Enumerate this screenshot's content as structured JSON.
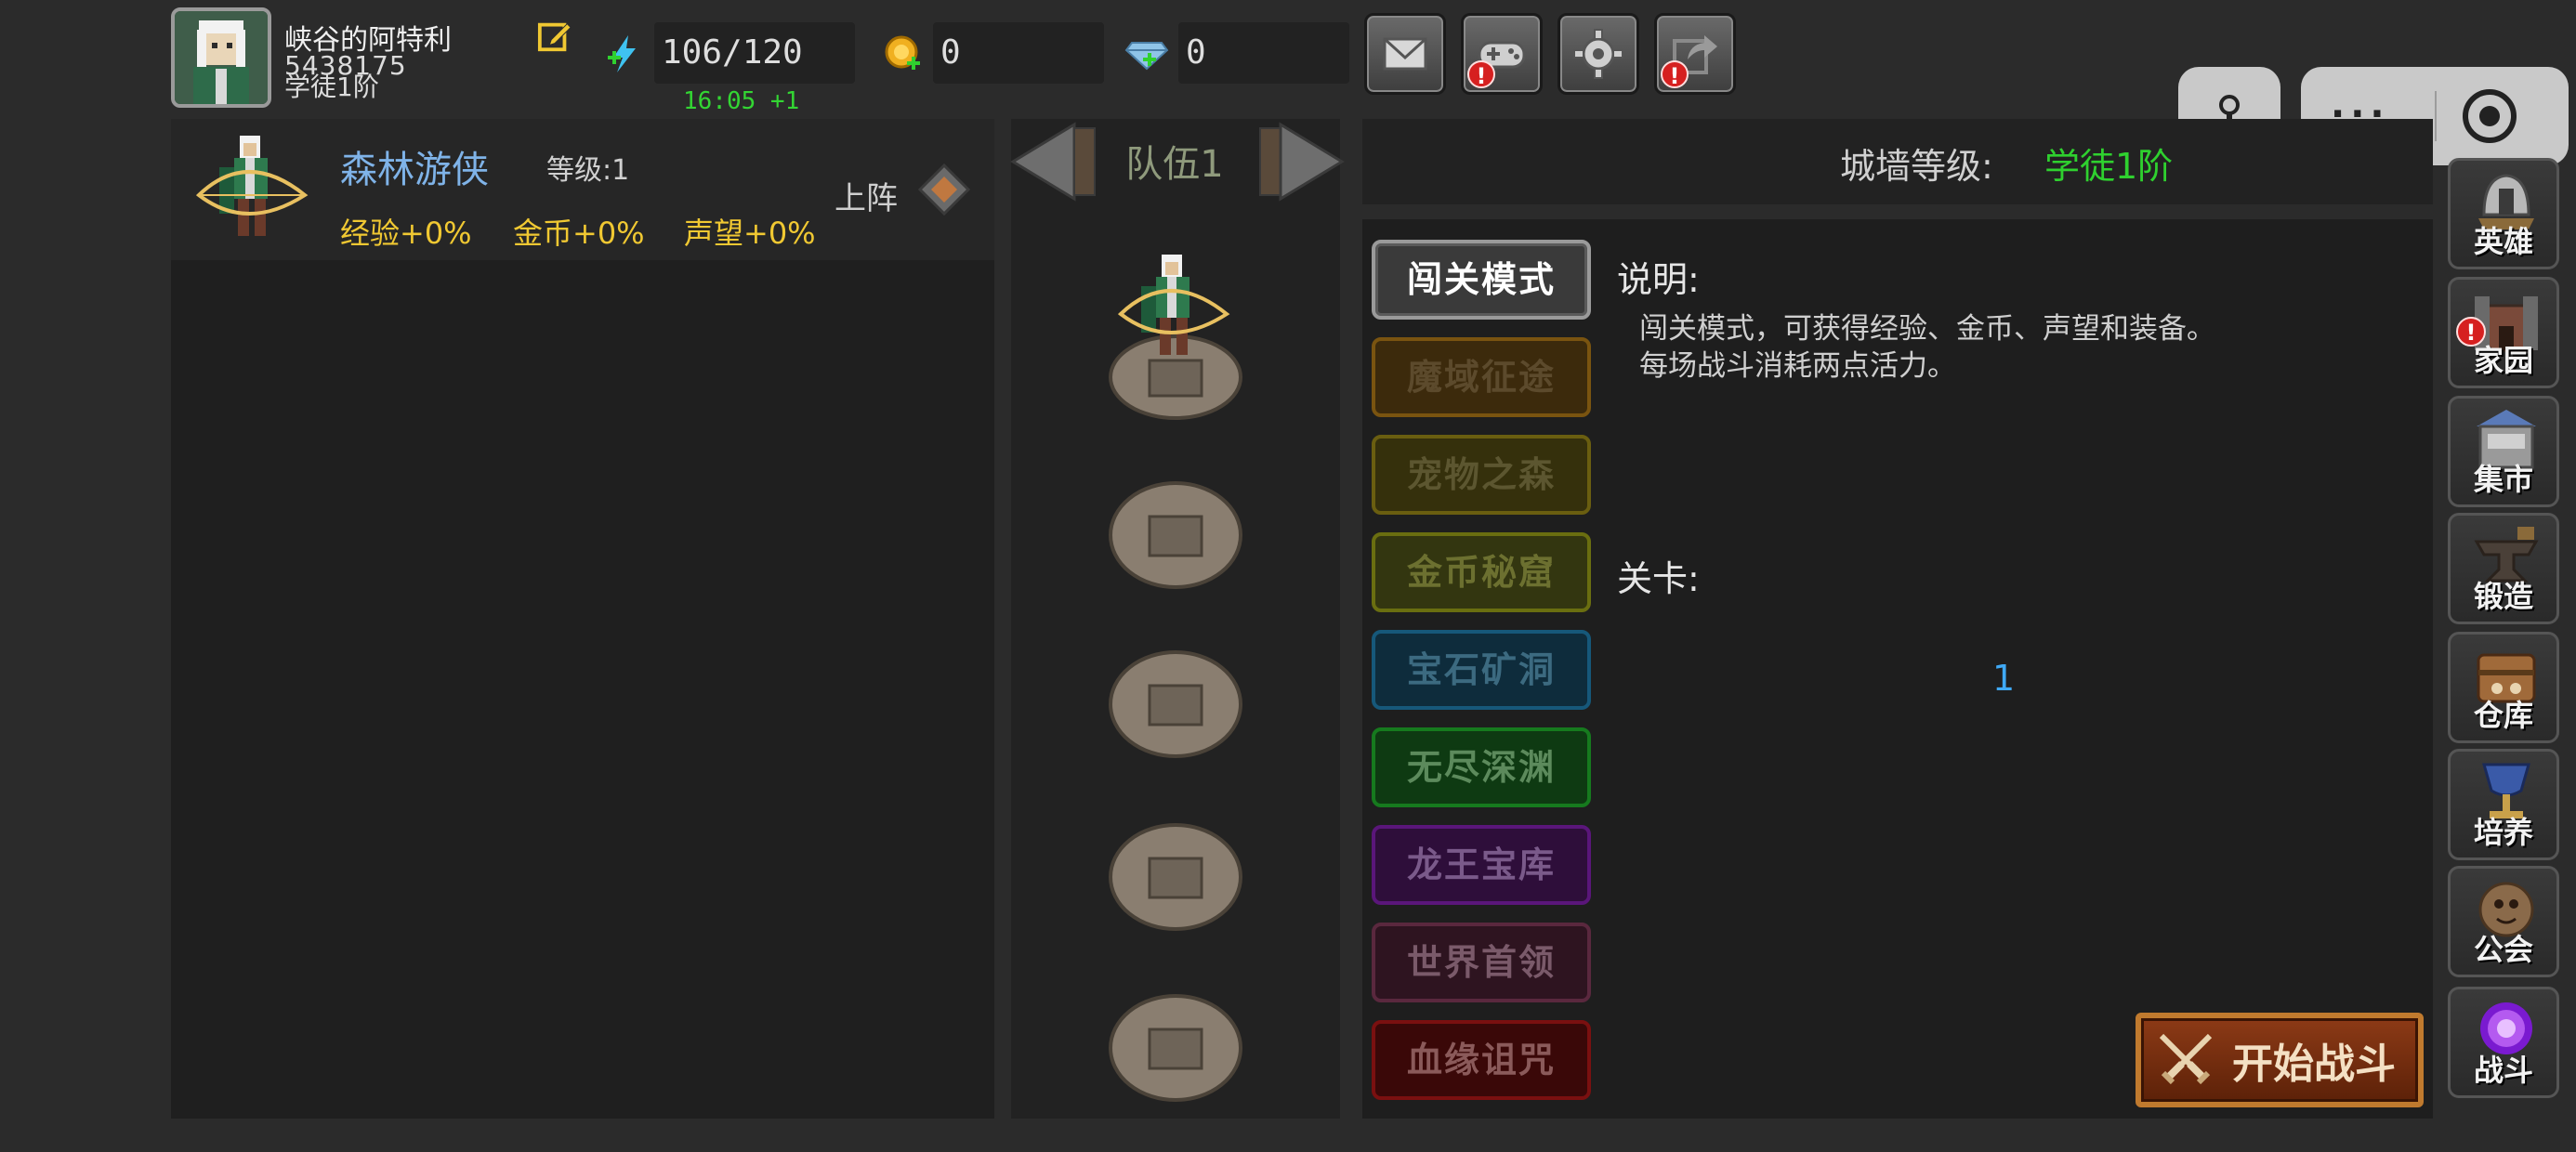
{
  "player": {
    "name": "峡谷的阿特利",
    "id": "5438175",
    "rank": "学徒1阶"
  },
  "resources": {
    "energy": "106/120",
    "energy_timer": "16:05 +1",
    "gold": "0",
    "gems": "0"
  },
  "toolbar": [
    {
      "icon": "mail-icon"
    },
    {
      "icon": "gamepad-icon",
      "alert": "!"
    },
    {
      "icon": "settings-icon"
    },
    {
      "icon": "share-icon",
      "alert": "!"
    }
  ],
  "wechat_capsule": {
    "more": "···"
  },
  "hero": {
    "name": "森林游侠",
    "level": "等级:1",
    "exp": "经验+0%",
    "gold": "金币+0%",
    "fame": "声望+0%",
    "deploy": "上阵"
  },
  "team": {
    "label": "队伍1"
  },
  "wall": {
    "label": "城墙等级:",
    "value": "学徒1阶"
  },
  "modes": [
    {
      "label": "闯关模式",
      "selected": true,
      "bg": "#3a3a3a",
      "border": "#9a9a9a",
      "color": "#ffffff"
    },
    {
      "label": "魔域征途",
      "bg": "#3c2a0c",
      "border": "#7a5410",
      "color": "#5c4a2c"
    },
    {
      "label": "宠物之森",
      "bg": "#35300c",
      "border": "#6a5e10",
      "color": "#5c5630"
    },
    {
      "label": "金币秘窟",
      "bg": "#333610",
      "border": "#6a6e10",
      "color": "#6c7030"
    },
    {
      "label": "宝石矿洞",
      "bg": "#0e2c3c",
      "border": "#16587a",
      "color": "#3c6a80"
    },
    {
      "label": "无尽深渊",
      "bg": "#0e3a12",
      "border": "#167a1e",
      "color": "#5c8a5c"
    },
    {
      "label": "龙王宝库",
      "bg": "#2e0e3a",
      "border": "#5a167a",
      "color": "#7a5a8a"
    },
    {
      "label": "世界首领",
      "bg": "#2e1420",
      "border": "#5a283e",
      "color": "#7a5a6a"
    },
    {
      "label": "血缘诅咒",
      "bg": "#3a0808",
      "border": "#7a1010",
      "color": "#8a5a5a"
    }
  ],
  "description": {
    "title": "说明:",
    "line1": "闯关模式，可获得经验、金币、声望和装备。",
    "line2": "每场战斗消耗两点活力。"
  },
  "stage": {
    "title": "关卡:",
    "value": "1"
  },
  "start_button": "开始战斗",
  "sidebar": [
    {
      "label": "英雄",
      "icon": "hero-helmet-icon"
    },
    {
      "label": "家园",
      "icon": "castle-icon",
      "alert": "!"
    },
    {
      "label": "集市",
      "icon": "market-icon"
    },
    {
      "label": "锻造",
      "icon": "anvil-icon"
    },
    {
      "label": "仓库",
      "icon": "warehouse-icon"
    },
    {
      "label": "培养",
      "icon": "chalice-icon"
    },
    {
      "label": "公会",
      "icon": "guild-icon"
    },
    {
      "label": "战斗",
      "icon": "portal-icon"
    }
  ]
}
